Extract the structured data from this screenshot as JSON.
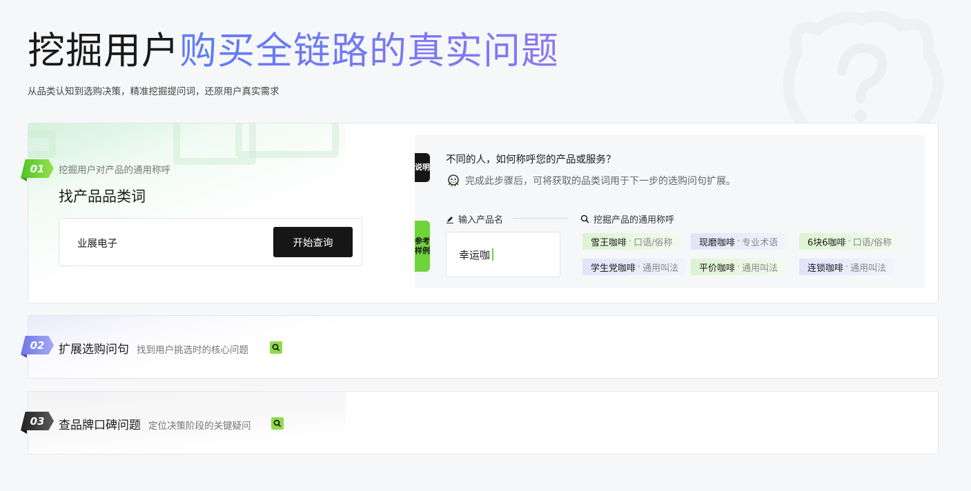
{
  "hero": {
    "title_dark": "挖掘用户",
    "title_accent": "购买全链路的真实问题",
    "subtitle": "从品类认知到选购决策，精准挖掘提问词，还原用户真实需求"
  },
  "steps": [
    {
      "badge": "01",
      "subtitle": "挖掘用户对产品的通用称呼",
      "title": "找产品品类词",
      "input_value": "业展电子",
      "button_label": "开始查询",
      "example": {
        "tag_explain": "说明",
        "tag_reference": "参考样例",
        "question": "不同的人，如何称呼您的产品或服务？",
        "note": "完成此步骤后，可将获取的品类词用于下一步的选购问句扩展。",
        "input_label": "输入产品名",
        "mine_label": "挖掘产品的通用称呼",
        "input_value": "幸运咖",
        "results": [
          {
            "name": "雪王咖啡",
            "kind": "口语/俗称",
            "color": "green"
          },
          {
            "name": "现磨咖啡",
            "kind": "专业术语",
            "color": "purple"
          },
          {
            "name": "6块6咖啡",
            "kind": "口语/俗称",
            "color": "green"
          },
          {
            "name": "学生党咖啡",
            "kind": "通用叫法",
            "color": "purple"
          },
          {
            "name": "平价咖啡",
            "kind": "通用叫法",
            "color": "green"
          },
          {
            "name": "连锁咖啡",
            "kind": "通用叫法",
            "color": "purple"
          }
        ]
      }
    },
    {
      "badge": "02",
      "title": "扩展选购问句",
      "subtitle": "找到用户挑选时的核心问题"
    },
    {
      "badge": "03",
      "title": "查品牌口碑问题",
      "subtitle": "定位决策阶段的关键疑问"
    }
  ],
  "colors": {
    "green_accent": "#6fd33a",
    "purple_accent": "#6e76e8",
    "dark_button": "#161616"
  },
  "icons": [
    "question-mascot-icon",
    "robot-icon",
    "pen-icon",
    "search-icon"
  ],
  "dot": "·"
}
